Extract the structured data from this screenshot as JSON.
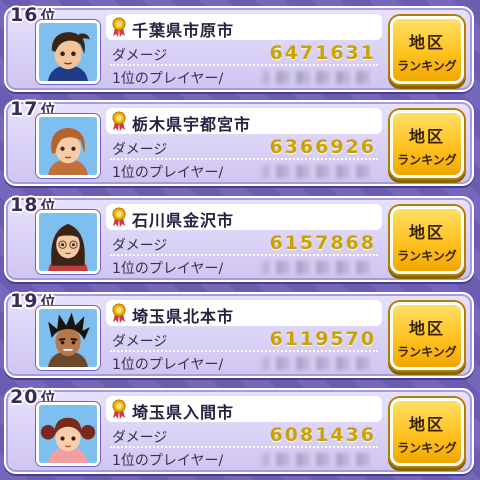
{
  "labels": {
    "damage": "ダメージ",
    "top_player": "1位のプレイヤー/",
    "rank_suffix": "位",
    "region_button_line1": "地区",
    "region_button_line2": "ランキング"
  },
  "colors": {
    "panel": "#d8cff5",
    "damage_value": "#c9a400",
    "button": "#ffc21f",
    "background": "#6e5fb8"
  },
  "entries": [
    {
      "rank": "16",
      "city": "千葉県市原市",
      "damage": "6471631",
      "avatar_icon": "boy-brown-hair-icon"
    },
    {
      "rank": "17",
      "city": "栃木県宇都宮市",
      "damage": "6366926",
      "avatar_icon": "woman-short-hair-icon"
    },
    {
      "rank": "18",
      "city": "石川県金沢市",
      "damage": "6157868",
      "avatar_icon": "woman-glasses-icon"
    },
    {
      "rank": "19",
      "city": "埼玉県北本市",
      "damage": "6119570",
      "avatar_icon": "man-spiky-hair-icon"
    },
    {
      "rank": "20",
      "city": "埼玉県入間市",
      "damage": "6081436",
      "avatar_icon": "girl-pigtails-icon"
    }
  ]
}
